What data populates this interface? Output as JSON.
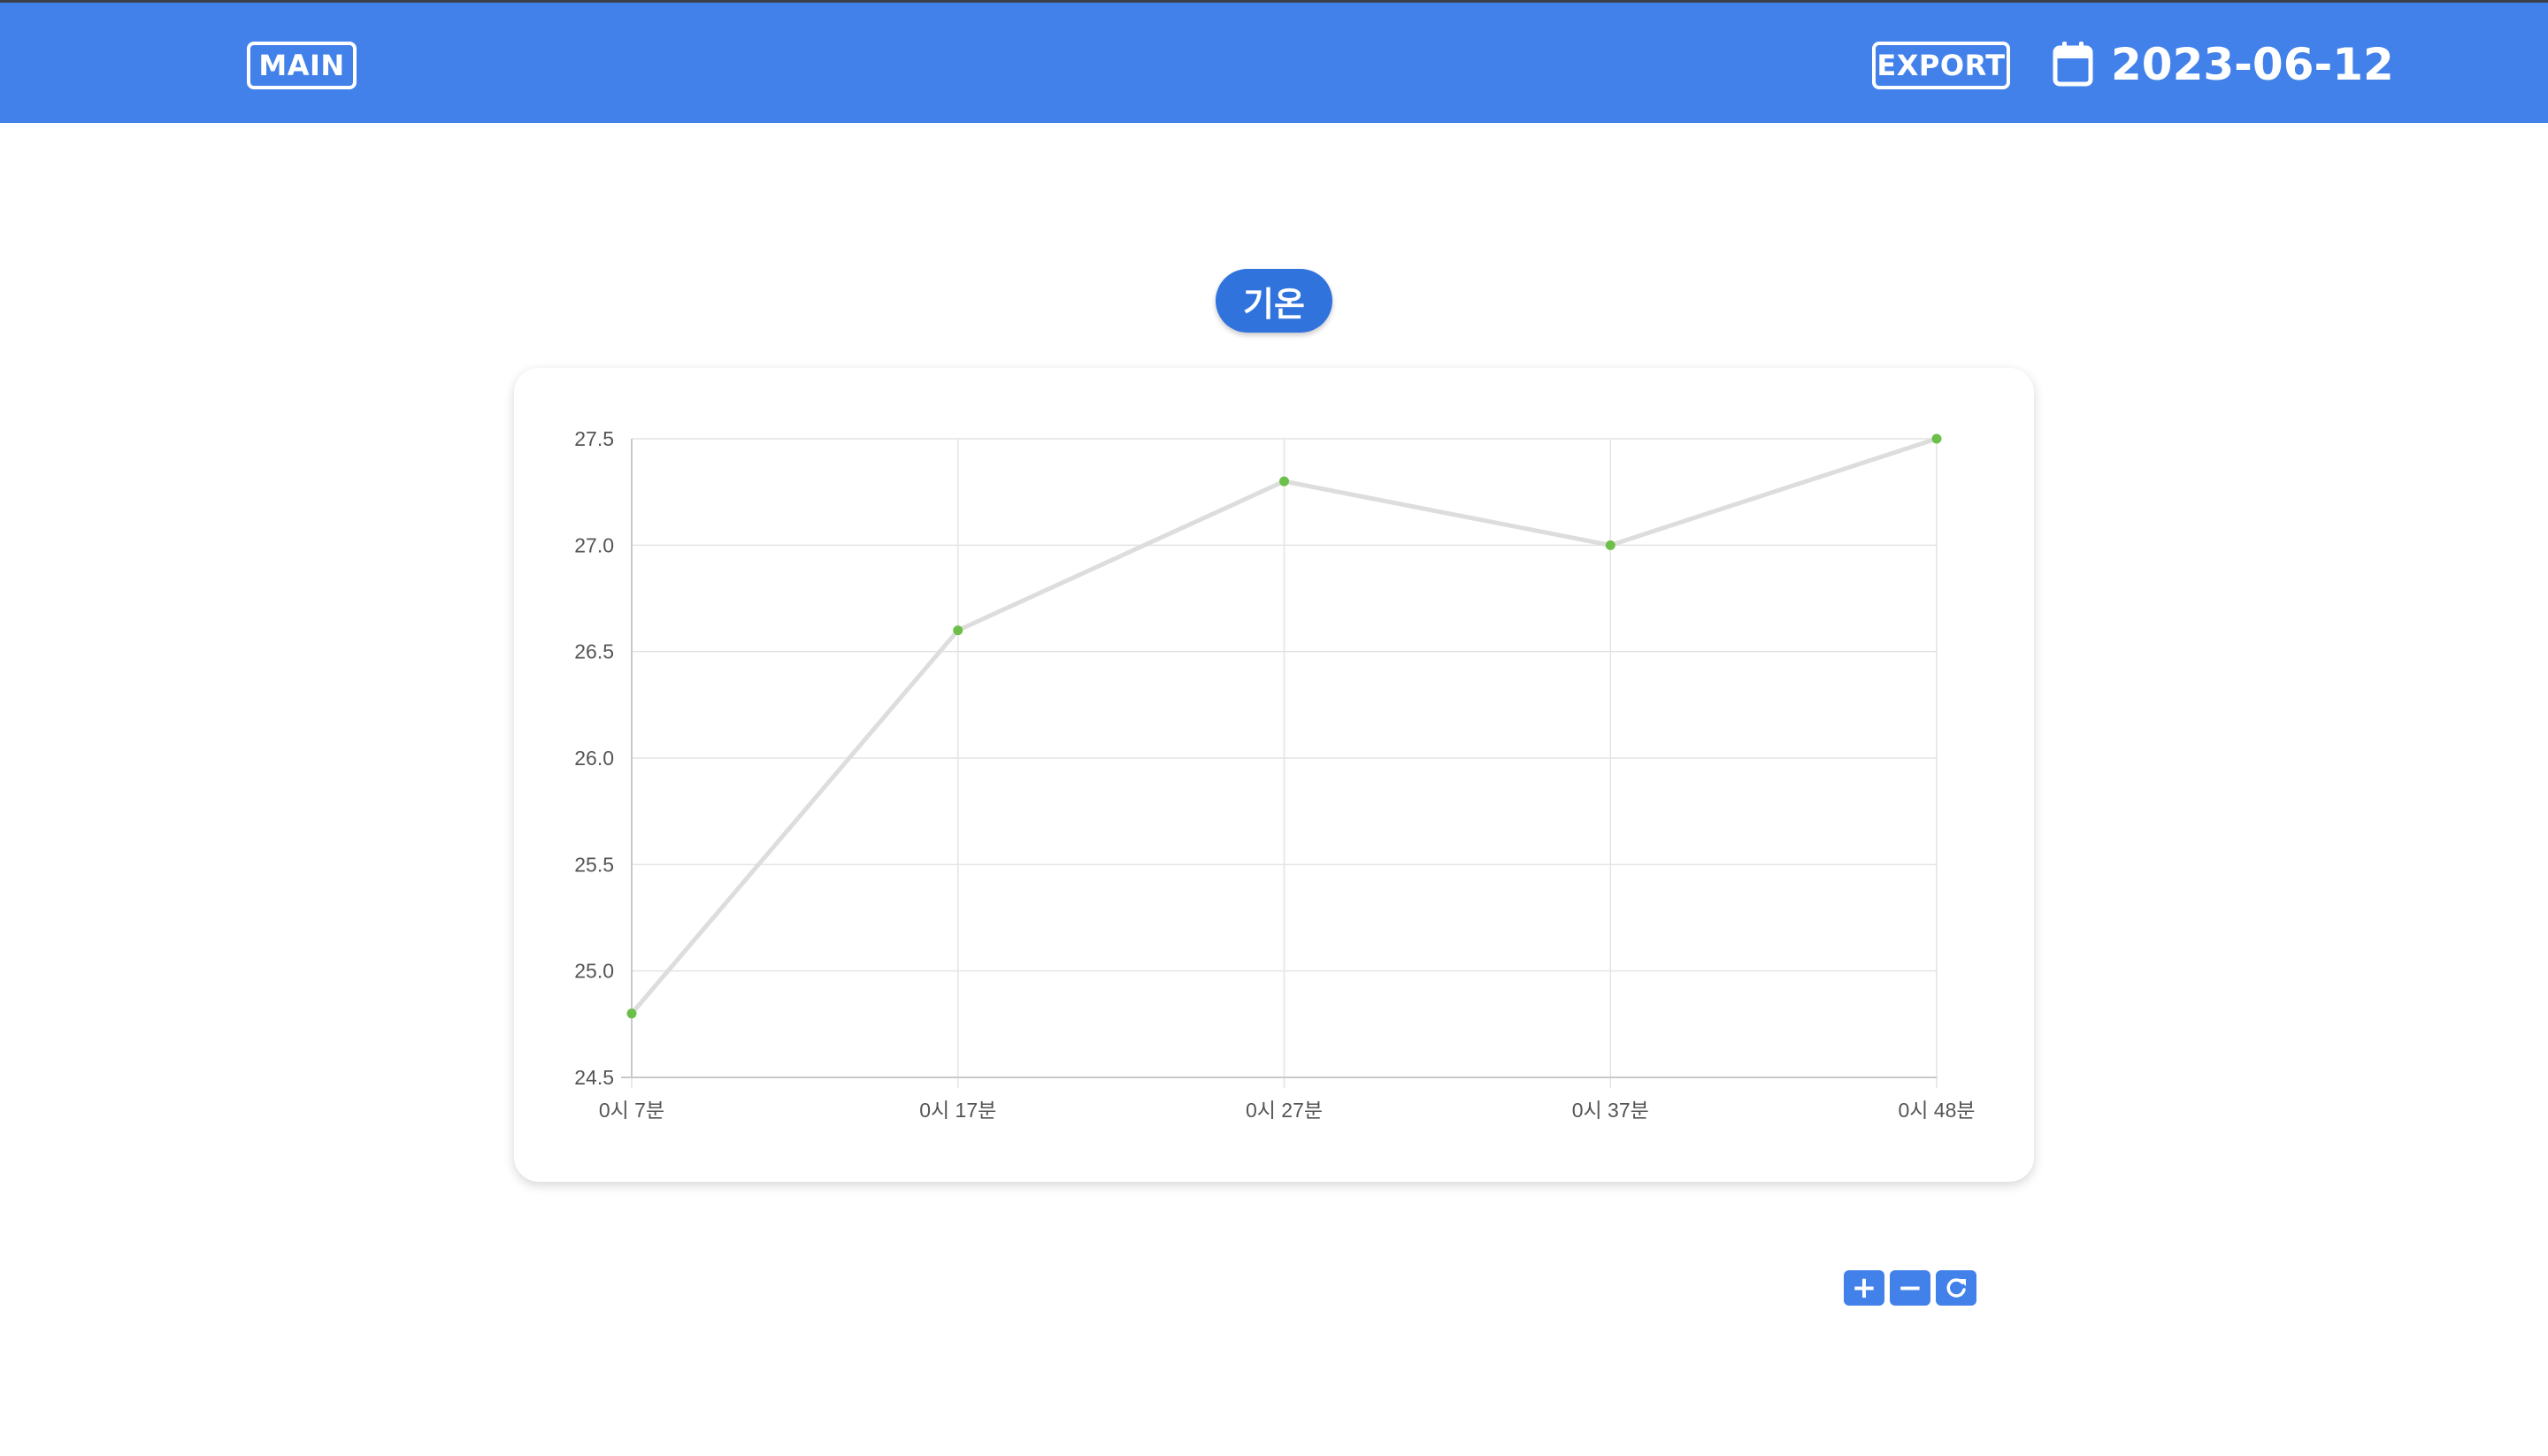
{
  "header": {
    "main_label": "MAIN",
    "export_label": "EXPORT",
    "date": "2023-06-12",
    "icon": "calendar-icon"
  },
  "title": "기온",
  "colors": {
    "header_bg": "#4281e9",
    "pill_bg": "#3173dd",
    "line": "#dddddd",
    "point": "#6cc04a",
    "grid": "#e4e4e4",
    "button_bg": "#4281e9"
  },
  "zoom_controls": [
    {
      "label": "+",
      "icon": "plus-icon"
    },
    {
      "label": "−",
      "icon": "minus-icon"
    },
    {
      "label": "",
      "icon": "reset-icon"
    }
  ],
  "chart_data": {
    "type": "line",
    "x": [
      "0시 7분",
      "0시 17분",
      "0시 27분",
      "0시 37분",
      "0시 48분"
    ],
    "series": [
      {
        "values": [
          24.8,
          26.6,
          27.3,
          27.0,
          27.5
        ]
      }
    ],
    "ylim": [
      24.5,
      27.5
    ],
    "yticks": [
      "27.5",
      "27.0",
      "26.5",
      "26.0",
      "25.5",
      "25.0",
      "24.5"
    ],
    "grid": true,
    "legend": false
  }
}
